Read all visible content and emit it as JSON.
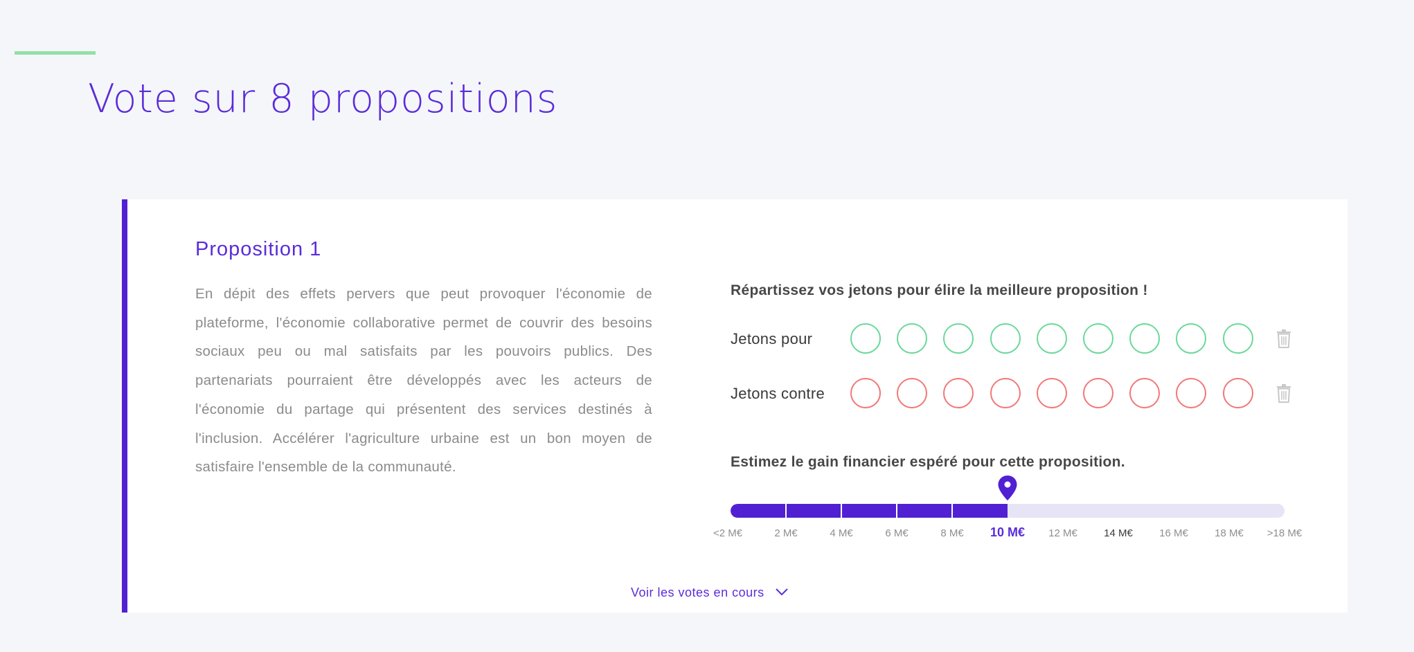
{
  "page": {
    "title": "Vote sur 8 propositions"
  },
  "proposition": {
    "title": "Proposition 1",
    "description": "En dépit des effets pervers que peut provoquer l'économie de plateforme, l'économie collaborative permet de couvrir des besoins sociaux peu ou mal satisfaits par les pouvoirs publics. Des partenariats pourraient être développés avec les acteurs de l'économie du partage qui présentent des services destinés à l'inclusion. Accélérer l'agriculture urbaine est un bon moyen de satisfaire l'ensemble de la communauté."
  },
  "tokens": {
    "heading": "Répartissez vos jetons pour élire la meilleure proposition !",
    "pour": {
      "label": "Jetons pour",
      "count": 9,
      "color": "#6ad89a",
      "trash_icon": "trash-icon"
    },
    "contre": {
      "label": "Jetons contre",
      "count": 9,
      "color": "#f27777",
      "trash_icon": "trash-icon"
    }
  },
  "estimate": {
    "heading": "Estimez le gain financier espéré pour cette proposition.",
    "ticks": [
      "<2 M€",
      "2 M€",
      "4 M€",
      "6 M€",
      "8 M€",
      "10 M€",
      "12 M€",
      "14 M€",
      "16 M€",
      "18 M€",
      ">18 M€"
    ],
    "selected_index": 5,
    "pin_icon": "location-pin-icon"
  },
  "footer": {
    "see_votes_label": "Voir les votes en cours",
    "chevron_icon": "chevron-down-icon"
  },
  "colors": {
    "accent": "#5a2cd9",
    "accent_dark": "#5120d3",
    "accent_line": "#93e0a6",
    "token_pour": "#6ad89a",
    "token_contre": "#f27777"
  }
}
